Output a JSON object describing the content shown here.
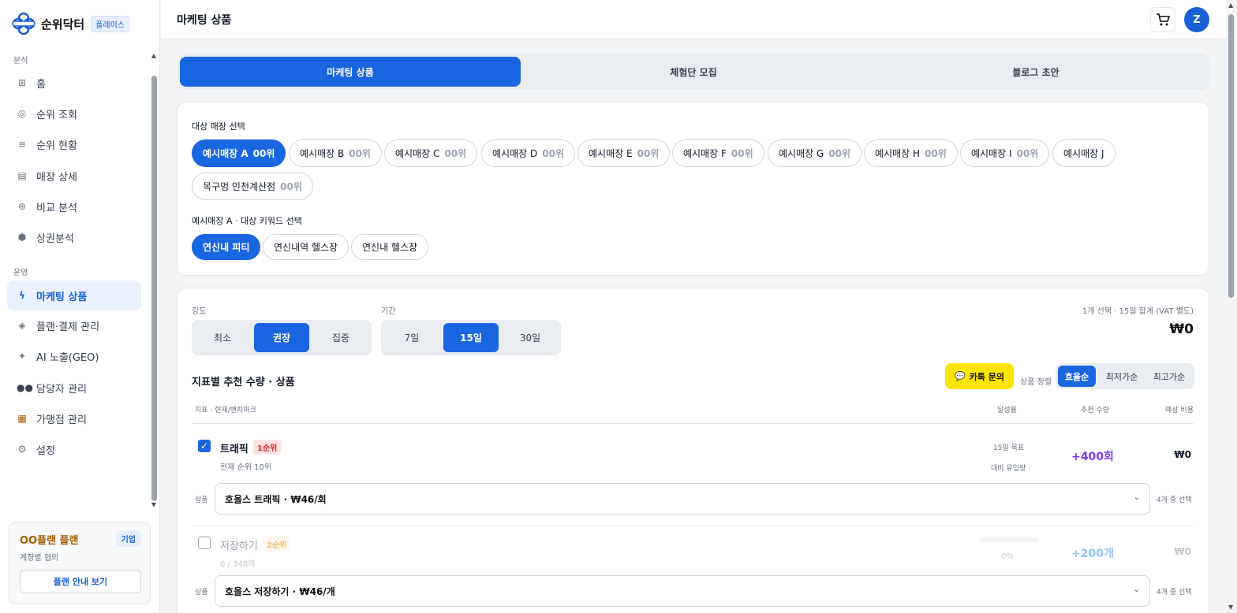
{
  "brand": {
    "name": "순위닥터",
    "badge": "플레이스"
  },
  "sidebar": {
    "section_analysis": "분석",
    "section_ops": "운영",
    "items": [
      {
        "label": "홈",
        "icon": "grid-icon"
      },
      {
        "label": "순위 조회",
        "icon": "circle-icon"
      },
      {
        "label": "순위 현황",
        "icon": "list-icon"
      },
      {
        "label": "매장 상세",
        "icon": "store-icon"
      },
      {
        "label": "비교 분석",
        "icon": "compare-icon"
      },
      {
        "label": "상권분석",
        "icon": "hexagon-icon"
      },
      {
        "label": "마케팅 상품",
        "icon": "lightning-icon"
      },
      {
        "label": "플랜·결제 관리",
        "icon": "diamond-icon"
      },
      {
        "label": "AI 노출(GEO)",
        "icon": "sparkle-icon"
      },
      {
        "label": "담당자 관리",
        "icon": "people-icon"
      },
      {
        "label": "가맹점 관리",
        "icon": "building-icon"
      },
      {
        "label": "설정",
        "icon": "gear-icon"
      }
    ],
    "plan": {
      "title": "OO플랜 플랜",
      "badge": "기업",
      "sub": "계정별 협의",
      "button": "플랜 안내 보기"
    }
  },
  "header": {
    "title": "마케팅 상품",
    "avatar": "Z"
  },
  "tabs": [
    "마케팅 상품",
    "체험단 모집",
    "블로그 초안"
  ],
  "store_select": {
    "label": "대상 매장 선택",
    "stores": [
      {
        "name": "예시매장 A",
        "rank": "00위"
      },
      {
        "name": "예시매장 B",
        "rank": "00위"
      },
      {
        "name": "예시매장 C",
        "rank": "00위"
      },
      {
        "name": "예시매장 D",
        "rank": "00위"
      },
      {
        "name": "예시매장 E",
        "rank": "00위"
      },
      {
        "name": "예시매장 F",
        "rank": "00위"
      },
      {
        "name": "예시매장 G",
        "rank": "00위"
      },
      {
        "name": "예시매장 H",
        "rank": "00위"
      },
      {
        "name": "예시매장 I",
        "rank": "00위"
      },
      {
        "name": "예시매장 J",
        "rank": ""
      },
      {
        "name": "목구멍 인천계산점",
        "rank": "00위"
      }
    ],
    "keyword_label": "예시매장 A · 대상 키워드 선택",
    "keywords": [
      "연신내 피티",
      "연신내역 헬스장",
      "연신내 헬스장"
    ]
  },
  "options": {
    "intensity_label": "강도",
    "intensity": [
      "최소",
      "권장",
      "집중"
    ],
    "period_label": "기간",
    "period": [
      "7일",
      "15일",
      "30일"
    ],
    "summary": "1개 선택 · 15일 합계 (VAT 별도)",
    "total": "₩0"
  },
  "products": {
    "title": "지표별 추천 수량 · 상품",
    "kakao": "카톡 문의",
    "sort_label": "상품 정렬",
    "sort": [
      "효율순",
      "최저가순",
      "최고가순"
    ],
    "col_metric": "지표 · 현재/벤치마크",
    "col_rate": "달성률",
    "col_rec": "추천 수량",
    "col_cost": "예상 비용",
    "rows": [
      {
        "name": "트래픽",
        "rank": "1순위",
        "sub": "현재 순위 10위",
        "rate_top": "15일 목표",
        "rate_bottom": "대비 유입량",
        "rec": "+400회",
        "cost": "₩0",
        "product_label": "상품",
        "product": "호올스 트래픽 · ₩46/회",
        "count": "4개 중 선택"
      },
      {
        "name": "저장하기",
        "rank": "2순위",
        "sub": "0 / 348개",
        "rate": "0%",
        "rec": "+200개",
        "cost": "₩0",
        "product_label": "상품",
        "product": "호올스 저장하기 · ₩46/개",
        "count": "4개 중 선택"
      }
    ]
  },
  "colors": {
    "primary": "#1a66e0",
    "kakao": "#fee500",
    "rec1": "#7c3aed",
    "rec2": "#93c5fd"
  }
}
